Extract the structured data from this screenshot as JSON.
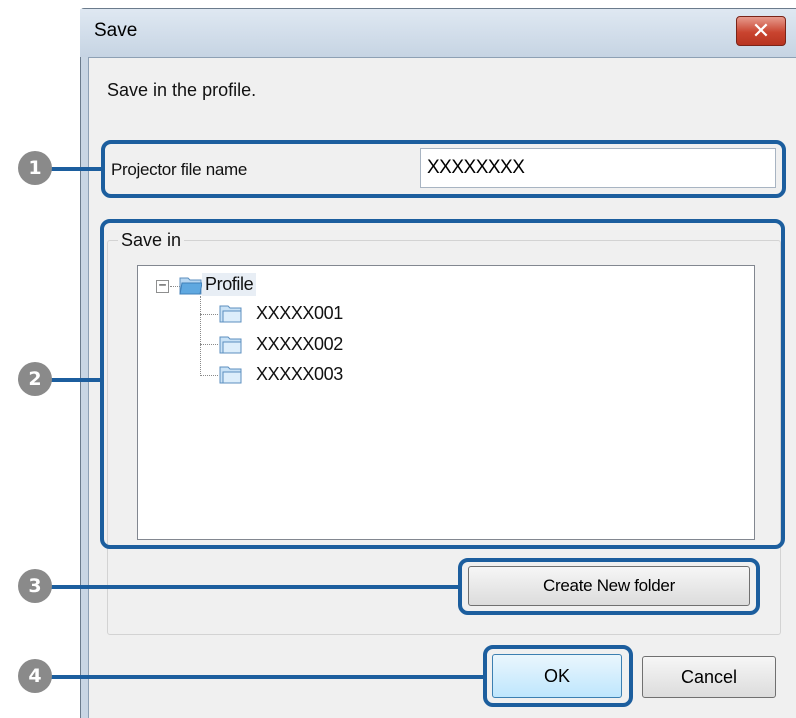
{
  "window": {
    "title": "Save",
    "close_icon": "close-icon"
  },
  "instruction": "Save in the profile.",
  "filename": {
    "label": "Projector file name",
    "value": "XXXXXXXX"
  },
  "save_in": {
    "legend": "Save in",
    "tree": {
      "root": {
        "label": "Profile",
        "expanded": true,
        "icon": "folder-open-icon"
      },
      "children": [
        {
          "label": "XXXXX001",
          "icon": "folder-icon"
        },
        {
          "label": "XXXXX002",
          "icon": "folder-icon"
        },
        {
          "label": "XXXXX003",
          "icon": "folder-icon"
        }
      ],
      "expander_glyph": "−"
    }
  },
  "buttons": {
    "create_folder": "Create New folder",
    "ok": "OK",
    "cancel": "Cancel"
  },
  "callouts": [
    "1",
    "2",
    "3",
    "4"
  ],
  "colors": {
    "callout": "#1c5e9e",
    "marker": "#8a8a8a",
    "close_button": "#c9442f",
    "folder": "#5fa8e0"
  }
}
